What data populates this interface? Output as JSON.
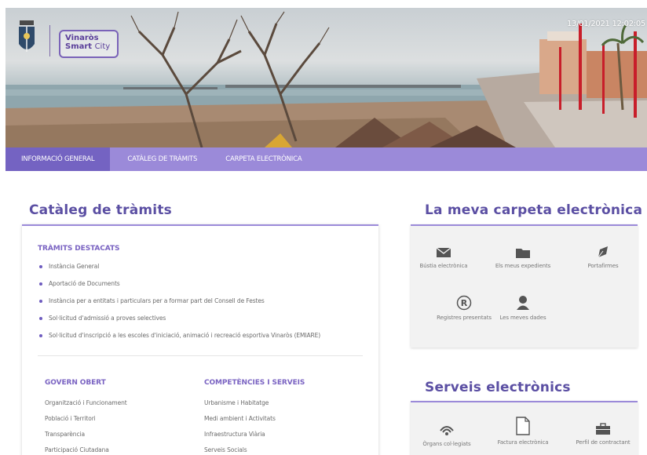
{
  "header": {
    "brand_line1": "Vinaròs",
    "brand_line2a": "Smart",
    "brand_line2b": "City",
    "timestamp": "13/01/2021 12:02:05"
  },
  "nav": {
    "items": [
      {
        "label": "Informació general",
        "active": true
      },
      {
        "label": "Catàleg de tràmits",
        "active": false
      },
      {
        "label": "Carpeta electrònica",
        "active": false
      }
    ]
  },
  "cataleg": {
    "title": "Catàleg de tràmits",
    "destacats_title": "TRÀMITS DESTACATS",
    "destacats": [
      "Instància General",
      "Aportació de Documents",
      "Instància per a entitats i particulars per a formar part del Consell de Festes",
      "Sol·licitud d'admissió a proves selectives",
      "Sol·licitud d'inscripció a les escoles d'iniciació, animació i recreació esportiva Vinaròs (EMIARE)"
    ],
    "govern_title": "GOVERN OBERT",
    "govern": [
      "Organització i Funcionament",
      "Població i Territori",
      "Transparència",
      "Participació Ciutadana"
    ],
    "compet_title": "COMPETÈNCIES I SERVEIS",
    "compet": [
      "Urbanisme i Habitatge",
      "Medi ambient i Activitats",
      "Infraestructura Viària",
      "Serveis Socials"
    ]
  },
  "carpeta": {
    "title": "La meva carpeta electrònica",
    "tiles": [
      {
        "label": "Bústia electrònica",
        "icon": "envelope-icon"
      },
      {
        "label": "Els meus expedients",
        "icon": "folder-icon"
      },
      {
        "label": "Portafirmes",
        "icon": "pen-icon"
      },
      {
        "label": "Registres presentats",
        "icon": "registered-icon"
      },
      {
        "label": "Les meves dades",
        "icon": "user-icon"
      }
    ]
  },
  "serveis": {
    "title": "Serveis electrònics",
    "tiles": [
      {
        "label": "Òrgans col·legiats",
        "icon": "signal-icon"
      },
      {
        "label": "Factura electrònica",
        "icon": "document-icon"
      },
      {
        "label": "Perfil de contractant",
        "icon": "briefcase-icon"
      }
    ]
  },
  "colors": {
    "accent": "#9b8ad9",
    "accent_dark": "#7463c2",
    "title": "#5b4fa3"
  }
}
